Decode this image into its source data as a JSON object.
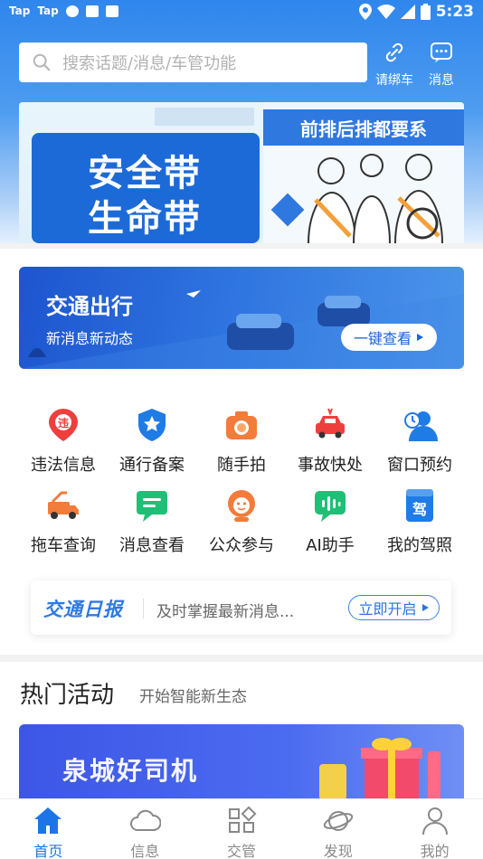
{
  "status_bar": {
    "left_labels": [
      "Tap",
      "Tap"
    ],
    "time": "5:23"
  },
  "search": {
    "placeholder": "搜索话题/消息/车管功能"
  },
  "header_actions": [
    {
      "label": "请绑车",
      "icon": "link-icon"
    },
    {
      "label": "消息",
      "icon": "chat-icon"
    }
  ],
  "banner": {
    "left_line1": "安全带",
    "left_line2": "生命带",
    "right_title": "前排后排都要系"
  },
  "traffic_banner": {
    "title": "交通出行",
    "subtitle": "新消息新动态",
    "button": "一键查看"
  },
  "grid": [
    {
      "label": "违法信息",
      "icon": "violation-pin-icon",
      "color": "#ef3f3c"
    },
    {
      "label": "通行备案",
      "icon": "shield-star-icon",
      "color": "#1f7be5"
    },
    {
      "label": "随手拍",
      "icon": "camera-icon",
      "color": "#f27c3a"
    },
    {
      "label": "事故快处",
      "icon": "car-accident-icon",
      "color": "#ef3f3c"
    },
    {
      "label": "窗口预约",
      "icon": "user-appointment-icon",
      "color": "#1f7be5"
    },
    {
      "label": "拖车查询",
      "icon": "tow-truck-icon",
      "color": "#f27c3a"
    },
    {
      "label": "消息查看",
      "icon": "message-icon",
      "color": "#1fbf76"
    },
    {
      "label": "公众参与",
      "icon": "public-participation-icon",
      "color": "#f27c3a"
    },
    {
      "label": "AI助手",
      "icon": "voice-assistant-icon",
      "color": "#1fbf76"
    },
    {
      "label": "我的驾照",
      "icon": "license-icon",
      "color": "#1f7be5"
    }
  ],
  "daily": {
    "title": "交通日报",
    "text": "及时掌握最新消息...",
    "button": "立即开启"
  },
  "hot": {
    "title": "热门活动",
    "subtitle": "开始智能新生态",
    "banner_title": "泉城好司机"
  },
  "bottom_nav": [
    {
      "label": "首页",
      "icon": "home-icon",
      "active": true
    },
    {
      "label": "信息",
      "icon": "cloud-icon",
      "active": false
    },
    {
      "label": "交管",
      "icon": "apps-icon",
      "active": false
    },
    {
      "label": "发现",
      "icon": "planet-icon",
      "active": false
    },
    {
      "label": "我的",
      "icon": "profile-icon",
      "active": false
    }
  ],
  "colors": {
    "primary": "#1d74e6",
    "header_top": "#2f86ec"
  }
}
